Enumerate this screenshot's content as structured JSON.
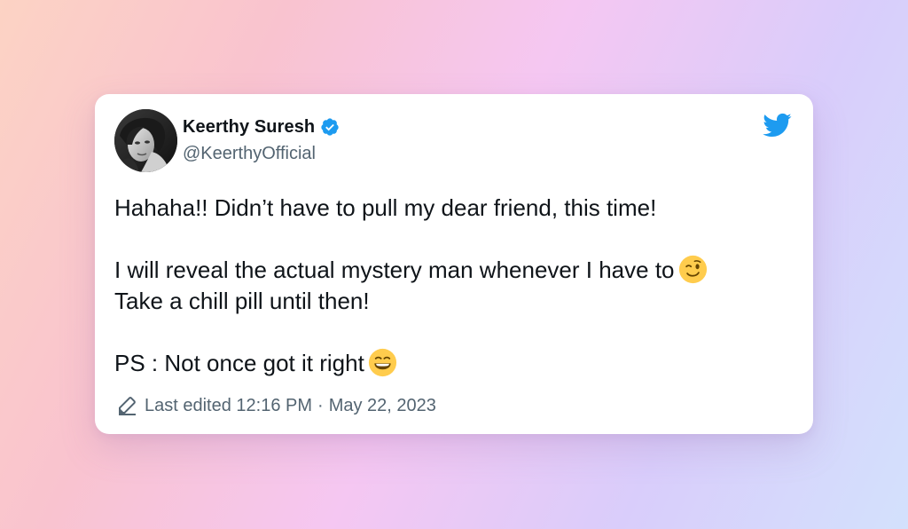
{
  "tweet": {
    "author": {
      "display_name": "Keerthy Suresh",
      "handle": "@KeerthyOfficial",
      "verified": true,
      "verified_icon": "verified-badge-icon",
      "avatar": "avatar-photo"
    },
    "brand_icon": "twitter-bird-icon",
    "lines": [
      {
        "text": "Hahaha!! Didn’t have to pull my dear friend, this time!",
        "emoji": null
      },
      {
        "text": "I will reveal the actual mystery man whenever I have to",
        "emoji": "winking-face-emoji"
      },
      {
        "text": "Take a chill pill until then!",
        "emoji": null
      },
      {
        "text": "PS : Not once got it right",
        "emoji": "grinning-squinting-face-emoji"
      }
    ],
    "edited": {
      "icon": "pencil-icon",
      "label": "Last edited",
      "time": "12:16 PM",
      "separator": "·",
      "date": "May 22, 2023"
    }
  },
  "colors": {
    "accent": "#1d9bf0",
    "text": "#0f1419",
    "secondary_text": "#536471",
    "emoji_yellow": "#ffcc4d"
  }
}
